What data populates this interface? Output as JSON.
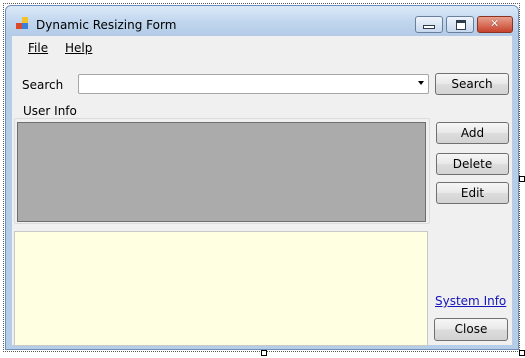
{
  "window": {
    "title": "Dynamic Resizing Form"
  },
  "menu": {
    "items": [
      {
        "label": "File"
      },
      {
        "label": "Help"
      }
    ]
  },
  "search": {
    "label": "Search",
    "value": "",
    "button_label": "Search"
  },
  "user_info": {
    "group_label": "User Info"
  },
  "actions": {
    "add_label": "Add",
    "delete_label": "Delete",
    "edit_label": "Edit"
  },
  "footer": {
    "system_info_link": "System Info",
    "close_label": "Close"
  },
  "colors": {
    "grid_background": "#ababab",
    "info_panel_background": "#ffffe1",
    "link": "#1515b8"
  }
}
